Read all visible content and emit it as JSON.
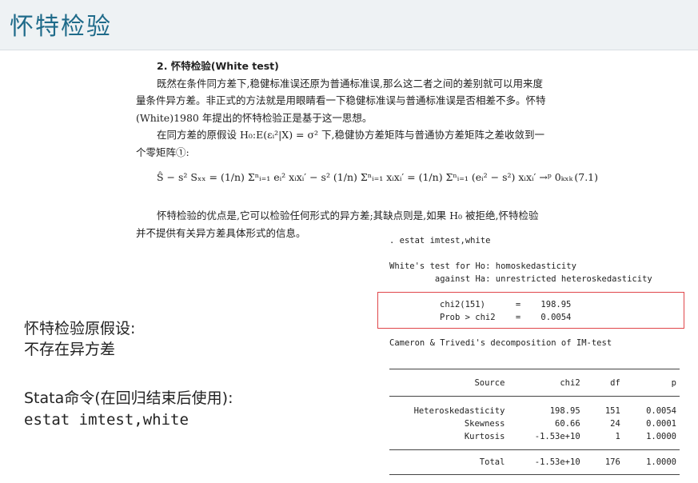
{
  "header": {
    "title": "怀特检验"
  },
  "book": {
    "section_title": "2. 怀特检验(White test)",
    "para1_line1": "既然在条件同方差下,稳健标准误还原为普通标准误,那么这二者之间的差别就可以用来度",
    "para1_line2": "量条件异方差。非正式的方法就是用眼睛看一下稳健标准误与普通标准误是否相差不多。怀特",
    "para1_line3": "(White)1980 年提出的怀特检验正是基于这一思想。",
    "para2_line1": "在同方差的原假设 H₀:E(εᵢ²|X) = σ² 下,稳健协方差矩阵与普通协方差矩阵之差收敛到一",
    "para2_line2": "个零矩阵①:",
    "formula": "Ŝ − s² Sₓₓ = (1/n) Σⁿᵢ₌₁ eᵢ² xᵢxᵢ′ − s² (1/n) Σⁿᵢ₌₁ xᵢxᵢ′ = (1/n) Σⁿᵢ₌₁ (eᵢ² − s²) xᵢxᵢ′ →ᵖ 0ₖₓₖ",
    "formula_no": "(7.1)",
    "para3_line1": "怀特检验的优点是,它可以检验任何形式的异方差;其缺点则是,如果 H₀ 被拒绝,怀特检验",
    "para3_line2": "并不提供有关异方差具体形式的信息。"
  },
  "stata": {
    "command": ". estat imtest,white",
    "white_line1": "White's test for Ho: homoskedasticity",
    "white_line2": "         against Ha: unrestricted heteroskedasticity",
    "chi2_line": "chi2(151)      =    198.95",
    "prob_line": "Prob > chi2    =    0.0054",
    "cameron": "Cameron & Trivedi's decomposition of IM-test",
    "table": {
      "headers": [
        "Source",
        "chi2",
        "df",
        "p"
      ],
      "rows": [
        [
          "Heteroskedasticity",
          "198.95",
          "151",
          "0.0054"
        ],
        [
          "Skewness",
          "60.66",
          "24",
          "0.0001"
        ],
        [
          "Kurtosis",
          "-1.53e+10",
          "1",
          "1.0000"
        ]
      ],
      "total": [
        "Total",
        "-1.53e+10",
        "176",
        "1.0000"
      ]
    }
  },
  "notes": {
    "null_hypothesis_line1": "怀特检验原假设:",
    "null_hypothesis_line2": "不存在异方差",
    "stata_line1": "Stata命令(在回归结束后使用):",
    "stata_line2": "estat imtest,white"
  },
  "colors": {
    "title": "#1f6b8a",
    "highlight_box": "#e0464a",
    "header_bg": "#eef2f4"
  }
}
